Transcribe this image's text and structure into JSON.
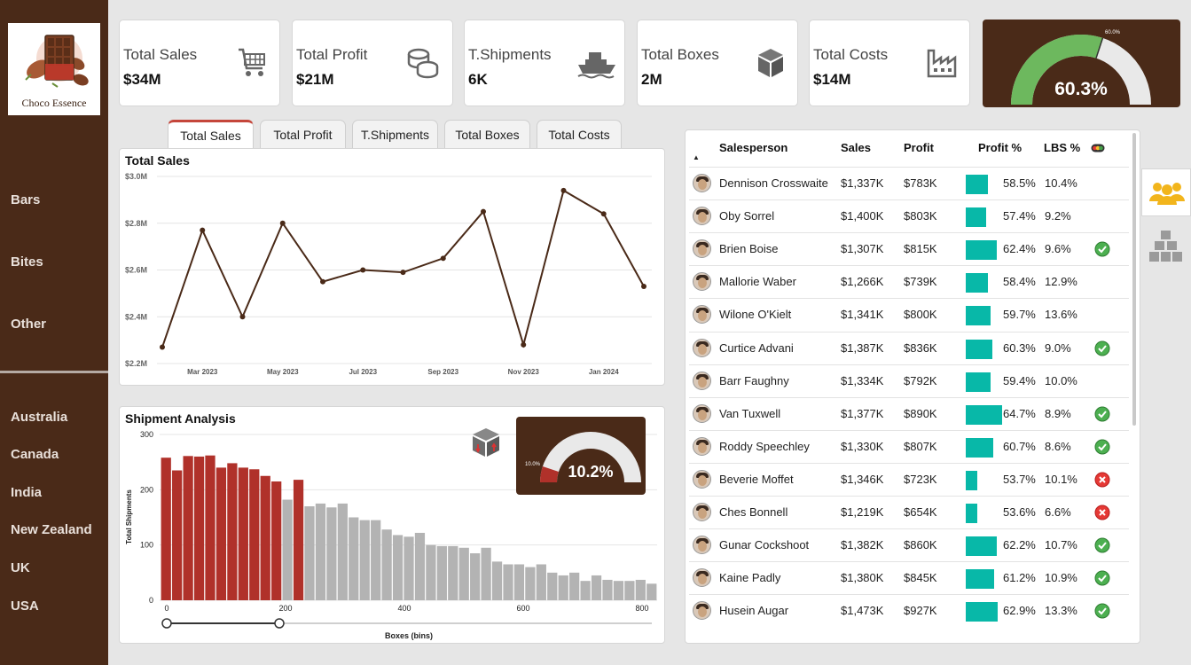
{
  "sidebar": {
    "logo_text": "Choco Essence",
    "categories": [
      "Bars",
      "Bites",
      "Other"
    ],
    "countries": [
      "Australia",
      "Canada",
      "India",
      "New Zealand",
      "UK",
      "USA"
    ]
  },
  "kpis": [
    {
      "label": "Total Sales",
      "value": "$34M",
      "icon": "shopping-cart-icon"
    },
    {
      "label": "Total Profit",
      "value": "$21M",
      "icon": "coins-icon"
    },
    {
      "label": "T.Shipments",
      "value": "6K",
      "icon": "ship-icon"
    },
    {
      "label": "Total Boxes",
      "value": "2M",
      "icon": "box-icon"
    },
    {
      "label": "Total Costs",
      "value": "$14M",
      "icon": "factory-icon"
    }
  ],
  "profit_gauge": {
    "value": "60.3%",
    "target_label": "60.0%",
    "fraction": 0.603,
    "color": "#6db85e"
  },
  "tabs": [
    "Total Sales",
    "Total Profit",
    "T.Shipments",
    "Total Boxes",
    "Total Costs"
  ],
  "active_tab": "Total Sales",
  "sales_chart": {
    "title": "Total Sales",
    "chart_data": {
      "type": "line",
      "x": [
        "Feb 2023",
        "Mar 2023",
        "Apr 2023",
        "May 2023",
        "Jun 2023",
        "Jul 2023",
        "Aug 2023",
        "Sep 2023",
        "Oct 2023",
        "Nov 2023",
        "Dec 2023",
        "Jan 2024",
        "Feb 2024"
      ],
      "values": [
        2.27,
        2.77,
        2.4,
        2.8,
        2.55,
        2.6,
        2.59,
        2.65,
        2.85,
        2.28,
        2.94,
        2.84,
        2.53
      ],
      "y_tick_labels": [
        "$2.2M",
        "$2.4M",
        "$2.6M",
        "$2.8M",
        "$3.0M"
      ],
      "y_ticks": [
        2.2,
        2.4,
        2.6,
        2.8,
        3.0
      ],
      "x_tick_labels": [
        "Mar 2023",
        "May 2023",
        "Jul 2023",
        "Sep 2023",
        "Nov 2023",
        "Jan 2024"
      ],
      "x_tick_index": [
        1,
        3,
        5,
        7,
        9,
        11
      ],
      "ylim": [
        2.2,
        3.0
      ],
      "color": "#4a2a18",
      "grid": true
    }
  },
  "shipment_chart": {
    "title": "Shipment Analysis",
    "chart_data": {
      "type": "bar",
      "values": [
        258,
        235,
        261,
        260,
        262,
        240,
        248,
        240,
        237,
        225,
        215,
        182,
        218,
        170,
        175,
        168,
        175,
        150,
        145,
        145,
        128,
        118,
        115,
        122,
        100,
        98,
        98,
        95,
        85,
        95,
        70,
        65,
        65,
        60,
        65,
        50,
        45,
        50,
        35,
        45,
        37,
        35,
        35,
        37,
        30
      ],
      "highlight": [
        true,
        true,
        true,
        true,
        true,
        true,
        true,
        true,
        true,
        true,
        true,
        false,
        true,
        false,
        false,
        false,
        false,
        false,
        false,
        false,
        false,
        false,
        false,
        false,
        false,
        false,
        false,
        false,
        false,
        false,
        false,
        false,
        false,
        false,
        false,
        false,
        false,
        false,
        false,
        false,
        false,
        false,
        false,
        false,
        false
      ],
      "xlabel": "Boxes (bins)",
      "ylabel": "Total Shipments",
      "x_tick_labels": [
        "0",
        "200",
        "400",
        "600",
        "800"
      ],
      "x_ticks": [
        0,
        200,
        400,
        600,
        800
      ],
      "y_tick_labels": [
        "0",
        "100",
        "200",
        "300"
      ],
      "y_ticks": [
        0,
        100,
        200,
        300
      ],
      "xlim": [
        0,
        820
      ],
      "ylim": [
        0,
        300
      ],
      "highlight_color": "#b0312a",
      "base_color": "#b3b3b3",
      "slider_range": [
        0,
        200
      ]
    },
    "gauge": {
      "value": "10.2%",
      "target_label": "10.0%",
      "fraction": 0.102
    }
  },
  "table": {
    "headers": [
      "Salesperson",
      "Sales",
      "Profit",
      "Profit %",
      "LBS %"
    ],
    "sort_indicator": "▲",
    "rows": [
      {
        "name": "Dennison Crosswaite",
        "sales": "$1,337K",
        "profit": "$783K",
        "pct": "58.5%",
        "pct_num": 58.5,
        "lbs": "10.4%",
        "status": ""
      },
      {
        "name": "Oby Sorrel",
        "sales": "$1,400K",
        "profit": "$803K",
        "pct": "57.4%",
        "pct_num": 57.4,
        "lbs": "9.2%",
        "status": ""
      },
      {
        "name": "Brien Boise",
        "sales": "$1,307K",
        "profit": "$815K",
        "pct": "62.4%",
        "pct_num": 62.4,
        "lbs": "9.6%",
        "status": "ok"
      },
      {
        "name": "Mallorie Waber",
        "sales": "$1,266K",
        "profit": "$739K",
        "pct": "58.4%",
        "pct_num": 58.4,
        "lbs": "12.9%",
        "status": ""
      },
      {
        "name": "Wilone O'Kielt",
        "sales": "$1,341K",
        "profit": "$800K",
        "pct": "59.7%",
        "pct_num": 59.7,
        "lbs": "13.6%",
        "status": ""
      },
      {
        "name": "Curtice Advani",
        "sales": "$1,387K",
        "profit": "$836K",
        "pct": "60.3%",
        "pct_num": 60.3,
        "lbs": "9.0%",
        "status": "ok"
      },
      {
        "name": "Barr Faughny",
        "sales": "$1,334K",
        "profit": "$792K",
        "pct": "59.4%",
        "pct_num": 59.4,
        "lbs": "10.0%",
        "status": ""
      },
      {
        "name": "Van Tuxwell",
        "sales": "$1,377K",
        "profit": "$890K",
        "pct": "64.7%",
        "pct_num": 64.7,
        "lbs": "8.9%",
        "status": "ok"
      },
      {
        "name": "Roddy Speechley",
        "sales": "$1,330K",
        "profit": "$807K",
        "pct": "60.7%",
        "pct_num": 60.7,
        "lbs": "8.6%",
        "status": "ok"
      },
      {
        "name": "Beverie Moffet",
        "sales": "$1,346K",
        "profit": "$723K",
        "pct": "53.7%",
        "pct_num": 53.7,
        "lbs": "10.1%",
        "status": "bad"
      },
      {
        "name": "Ches Bonnell",
        "sales": "$1,219K",
        "profit": "$654K",
        "pct": "53.6%",
        "pct_num": 53.6,
        "lbs": "6.6%",
        "status": "bad"
      },
      {
        "name": "Gunar Cockshoot",
        "sales": "$1,382K",
        "profit": "$860K",
        "pct": "62.2%",
        "pct_num": 62.2,
        "lbs": "10.7%",
        "status": "ok"
      },
      {
        "name": "Kaine Padly",
        "sales": "$1,380K",
        "profit": "$845K",
        "pct": "61.2%",
        "pct_num": 61.2,
        "lbs": "10.9%",
        "status": "ok"
      },
      {
        "name": "Husein Augar",
        "sales": "$1,473K",
        "profit": "$927K",
        "pct": "62.9%",
        "pct_num": 62.9,
        "lbs": "13.3%",
        "status": "ok"
      }
    ],
    "bar_color": "#08b8a8"
  },
  "right_icons": [
    "people-icon",
    "boxes-stack-icon"
  ]
}
